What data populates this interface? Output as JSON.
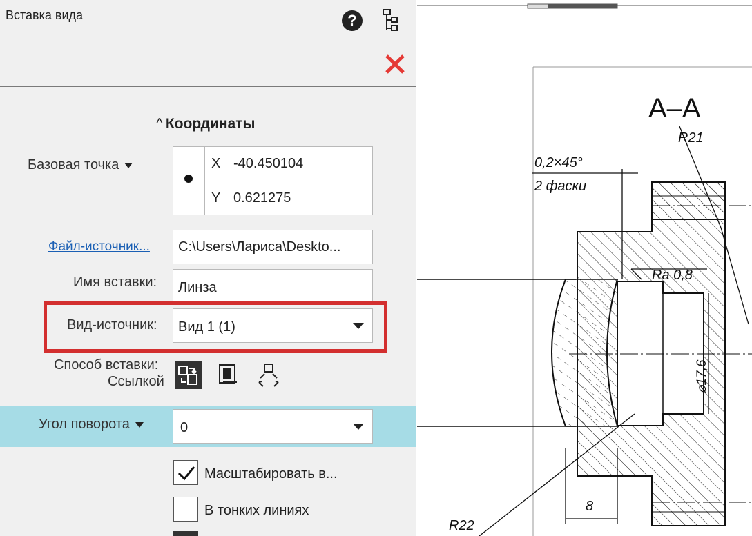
{
  "panel": {
    "title": "Вставка вида",
    "icons": [
      "help-icon",
      "tree-icon",
      "close-icon"
    ],
    "section_title": "Координаты",
    "base_point": {
      "label": "Базовая точка",
      "x_label": "X",
      "x_value": "-40.450104",
      "y_label": "Y",
      "y_value": "0.621275"
    },
    "source_file": {
      "label": "Файл-источник...",
      "value": "C:\\Users\\Лариса\\Deskto..."
    },
    "insert_name": {
      "label": "Имя вставки:",
      "value": "Линза"
    },
    "source_view": {
      "label": "Вид-источник:",
      "value": "Вид 1 (1)"
    },
    "insert_method": {
      "label": "Способ вставки:",
      "value": "Ссылкой"
    },
    "rotation": {
      "label": "Угол поворота",
      "value": "0"
    },
    "checkboxes": [
      {
        "label": "Масштабировать в...",
        "checked": true
      },
      {
        "label": "В тонких линиях",
        "checked": false
      }
    ]
  },
  "drawing": {
    "section_label": "А–А",
    "r21": "R21",
    "chamfer_top": "0,2×45°",
    "chamfer_bottom": "2 фаски",
    "roughness": "Ra 0,8",
    "diameter": "⌀17,6",
    "dim_8": "8",
    "r22": "R22"
  },
  "colors": {
    "panel_bg": "#f0f0f0",
    "highlight": "#d32f2f",
    "band": "#a6dce6",
    "link": "#1a5fb4",
    "close": "#e53935"
  }
}
